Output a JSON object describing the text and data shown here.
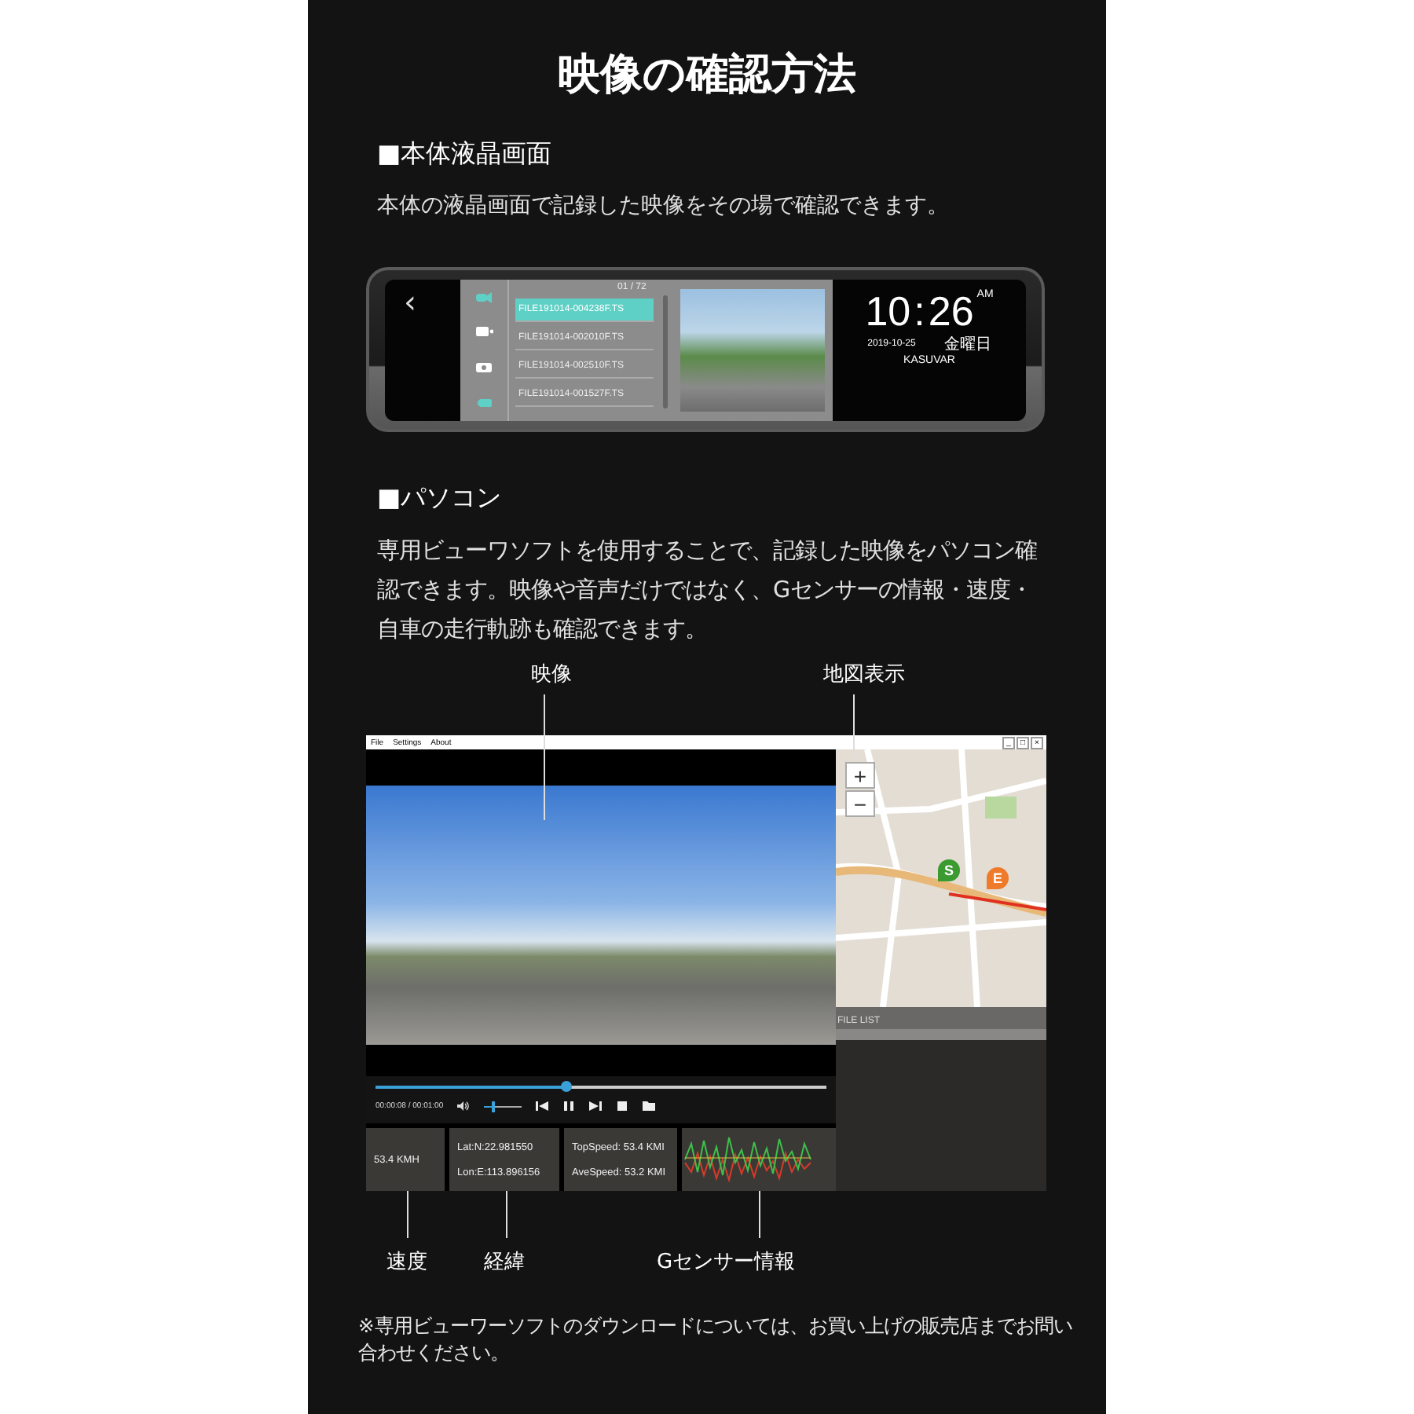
{
  "title": "映像の確認方法",
  "lcd_section": {
    "heading": "■本体液晶画面",
    "body": "本体の液晶画面で記録した映像をその場で確認できます。"
  },
  "mirror": {
    "back": "‹",
    "counter": "01 / 72",
    "mode_icons": [
      {
        "kind": "front-camera",
        "color": "#5fd0c6"
      },
      {
        "kind": "rear-camera",
        "color": "#ffffff"
      },
      {
        "kind": "photo",
        "color": "#ffffff"
      },
      {
        "kind": "lock",
        "color": "#5fd0c6"
      }
    ],
    "files": [
      {
        "name": "FILE191014-004238F.TS",
        "selected": true
      },
      {
        "name": "FILE191014-002010F.TS",
        "selected": false
      },
      {
        "name": "FILE191014-002510F.TS",
        "selected": false
      },
      {
        "name": "FILE191014-001527F.TS",
        "selected": false
      }
    ],
    "clock": {
      "hour": "10",
      "separator": ":",
      "minute": "26",
      "ampm": "AM",
      "date": "2019-10-25",
      "weekday": "金曜日",
      "brand": "KASUVAR"
    }
  },
  "pc_section": {
    "heading": "■パソコン",
    "body": "専用ビューワソフトを使用することで、記録した映像をパソコン確認できます。映像や音声だけではなく、Gセンサーの情報・速度・自車の走行軌跡も確認できます。"
  },
  "callouts_top": [
    "映像",
    "地図表示"
  ],
  "app": {
    "menu": [
      "File",
      "Settings",
      "About"
    ],
    "window_buttons": [
      "_",
      "□",
      "×"
    ],
    "seek": {
      "level": 0.42
    },
    "time": "00:00:08 / 00:01:00",
    "volume": {
      "level": 0.2
    },
    "speed": "53.4 KMH",
    "lat": "Lat:N:22.981550",
    "lon": "Lon:E:113.896156",
    "top_speed": "TopSpeed: 53.4 KMI",
    "ave_speed": "AveSpeed: 53.2 KMI",
    "map": {
      "zoom_in": "+",
      "zoom_out": "−",
      "start": "S",
      "end": "E"
    },
    "file_list": {
      "title": "FILE LIST"
    }
  },
  "callouts_bottom": [
    "速度",
    "経緯",
    "Gセンサー情報"
  ],
  "footnote": "※専用ビューワーソフトのダウンロードについては、お買い上げの販売店までお問い合わせください。"
}
